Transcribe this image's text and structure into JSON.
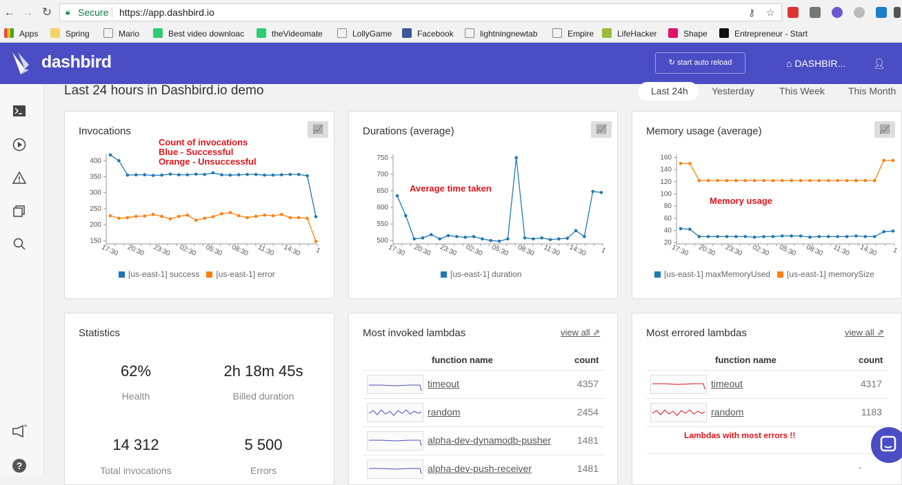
{
  "browser": {
    "url": "https://app.dashbird.io",
    "secure_label": "Secure",
    "bookmarks": [
      "Apps",
      "Spring",
      "Mario",
      "Best video downloac",
      "theVideomate",
      "LollyGame",
      "Facebook",
      "lightningnewtab",
      "Empire",
      "LifeHacker",
      "Shape",
      "Entrepreneur - Start"
    ]
  },
  "app": {
    "logo_text": "dashbird",
    "reload_label": "start auto reload",
    "dashboard_label": "DASHBIR...",
    "accent_color": "#4b4dc4"
  },
  "page": {
    "title": "Last 24 hours in Dashbird.io demo",
    "ranges": [
      "Last 24h",
      "Yesterday",
      "This Week",
      "This Month"
    ],
    "active_range": "Last 24h"
  },
  "invocations": {
    "title": "Invocations",
    "annotation": [
      "Count of invocations",
      "Blue - Successful",
      "Orange - Unsuccessful"
    ],
    "legend": [
      "[us-east-1] success",
      "[us-east-1] error"
    ]
  },
  "durations": {
    "title": "Durations (average)",
    "annotation": "Average time taken",
    "legend": [
      "[us-east-1] duration"
    ]
  },
  "memory": {
    "title": "Memory usage (average)",
    "annotation": "Memory usage",
    "legend": [
      "[us-east-1] maxMemoryUsed",
      "[us-east-1] memorySize"
    ]
  },
  "statistics": {
    "title": "Statistics",
    "items": [
      {
        "value": "62%",
        "label": "Health"
      },
      {
        "value": "2h 18m 45s",
        "label": "Billed duration"
      },
      {
        "value": "14 312",
        "label": "Total invocations"
      },
      {
        "value": "5 500",
        "label": "Errors"
      }
    ]
  },
  "most_invoked": {
    "title": "Most invoked lambdas",
    "view_all": "view all",
    "headers": [
      "function name",
      "count"
    ],
    "rows": [
      {
        "name": "timeout",
        "count": "4357"
      },
      {
        "name": "random",
        "count": "2454"
      },
      {
        "name": "alpha-dev-dynamodb-pusher",
        "count": "1481"
      },
      {
        "name": "alpha-dev-push-receiver",
        "count": "1481"
      }
    ]
  },
  "most_errored": {
    "title": "Most errored lambdas",
    "view_all": "view all",
    "headers": [
      "function name",
      "count"
    ],
    "rows": [
      {
        "name": "timeout",
        "count": "4317"
      },
      {
        "name": "random",
        "count": "1183"
      }
    ],
    "annotation": "Lambdas with most errors !!",
    "trailing": "-"
  },
  "chart_data": [
    {
      "type": "line",
      "title": "Invocations",
      "x_ticks": [
        "17:30",
        "20:30",
        "23:30",
        "02:30",
        "05:30",
        "08:30",
        "11:30",
        "14:30",
        "1"
      ],
      "ylim": [
        140,
        420
      ],
      "y_ticks": [
        150,
        200,
        250,
        300,
        350,
        400
      ],
      "series": [
        {
          "name": "[us-east-1] success",
          "color": "#1f77b4",
          "values": [
            418,
            400,
            355,
            356,
            356,
            354,
            355,
            358,
            356,
            356,
            358,
            357,
            362,
            356,
            355,
            356,
            357,
            357,
            355,
            355,
            356,
            357,
            357,
            353,
            225
          ]
        },
        {
          "name": "[us-east-1] error",
          "color": "#ff7f0e",
          "values": [
            228,
            220,
            222,
            226,
            227,
            232,
            226,
            218,
            226,
            230,
            214,
            220,
            225,
            234,
            238,
            228,
            222,
            226,
            230,
            228,
            232,
            222,
            222,
            220,
            148
          ]
        }
      ]
    },
    {
      "type": "line",
      "title": "Durations (average)",
      "x_ticks": [
        "17:30",
        "20:30",
        "23:30",
        "02:30",
        "05:30",
        "08:30",
        "11:30",
        "14:30",
        "1"
      ],
      "ylim": [
        490,
        760
      ],
      "y_ticks": [
        500,
        550,
        600,
        650,
        700,
        750
      ],
      "series": [
        {
          "name": "[us-east-1] duration",
          "color": "#1f77b4",
          "values": [
            635,
            575,
            505,
            508,
            518,
            505,
            515,
            512,
            510,
            512,
            505,
            500,
            498,
            505,
            750,
            508,
            505,
            508,
            503,
            505,
            507,
            530,
            512,
            648,
            645
          ]
        }
      ]
    },
    {
      "type": "line",
      "title": "Memory usage (average)",
      "x_ticks": [
        "17:30",
        "20:30",
        "23:30",
        "02:30",
        "05:30",
        "08:30",
        "11:30",
        "14:30",
        "1"
      ],
      "ylim": [
        18,
        165
      ],
      "y_ticks": [
        20,
        40,
        60,
        80,
        100,
        120,
        140,
        160
      ],
      "series": [
        {
          "name": "[us-east-1] maxMemoryUsed",
          "color": "#1f77b4",
          "values": [
            43,
            42,
            30,
            30,
            30,
            30,
            30,
            30,
            29,
            30,
            30,
            31,
            31,
            31,
            29,
            30,
            30,
            30,
            30,
            31,
            30,
            30,
            38,
            39
          ]
        },
        {
          "name": "[us-east-1] memorySize",
          "color": "#ff7f0e",
          "values": [
            150,
            150,
            122,
            122,
            122,
            122,
            122,
            122,
            122,
            122,
            122,
            122,
            122,
            122,
            122,
            122,
            122,
            122,
            122,
            122,
            122,
            122,
            155,
            155
          ]
        }
      ]
    }
  ]
}
